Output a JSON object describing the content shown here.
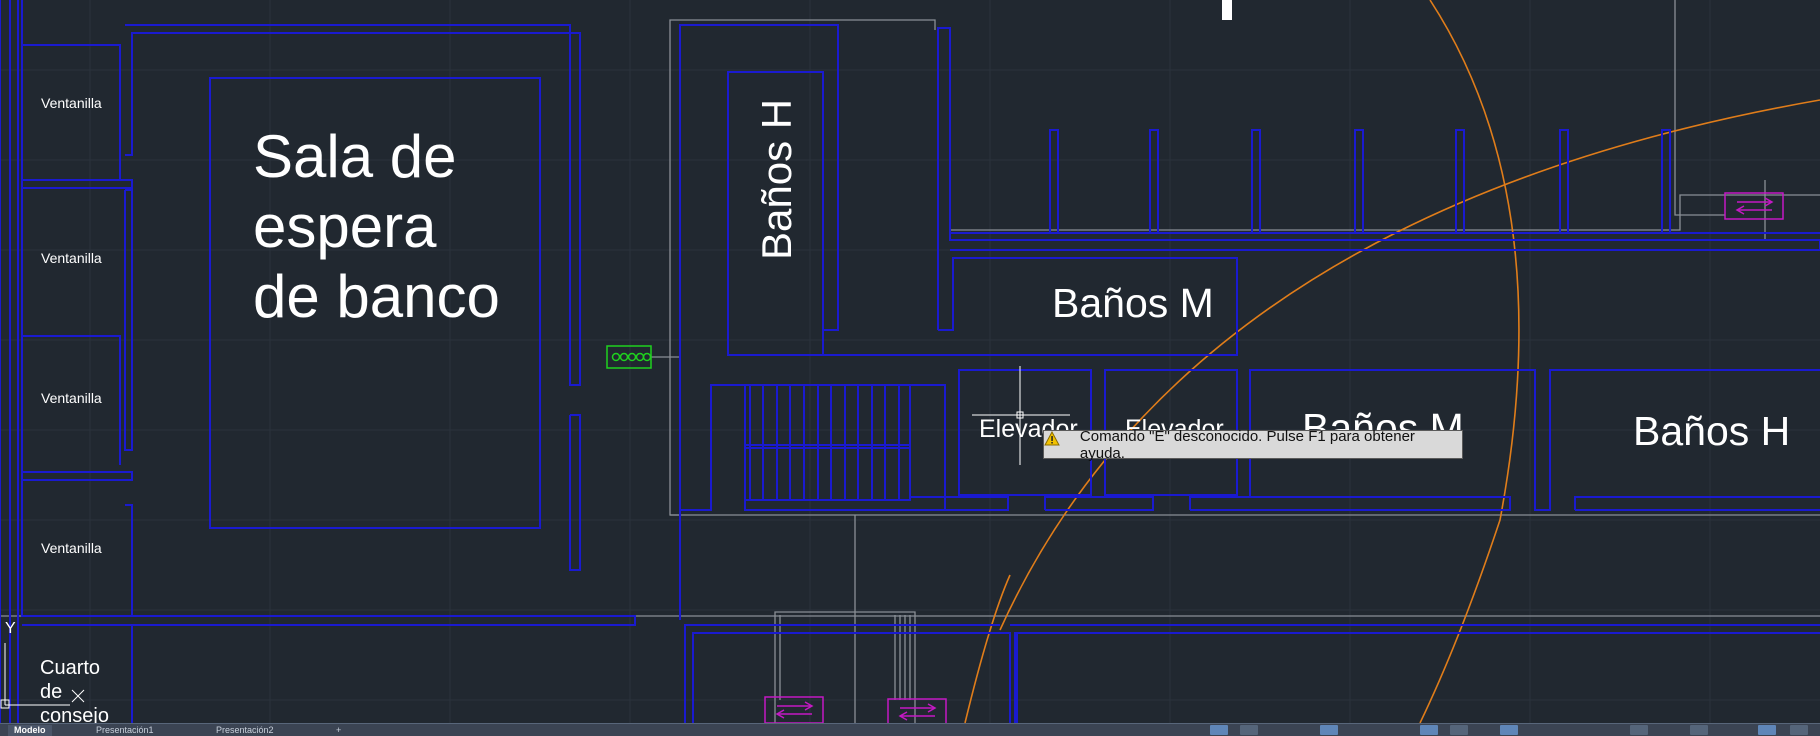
{
  "drawing": {
    "ventanillas": [
      "Ventanilla",
      "Ventanilla",
      "Ventanilla",
      "Ventanilla"
    ],
    "sala": "Sala de espera de banco",
    "banos_h_vertical": "Baños H",
    "banos_m_upper": "Baños M",
    "elevador_1": "Elevador",
    "elevador_2": "Elevador",
    "banos_m_lower": "Baños M",
    "banos_h_right": "Baños H",
    "cuarto": "Cuarto de consejo"
  },
  "tooltip": {
    "icon": "warning-icon",
    "message": "Comando \"E\" desconocido. Pulse F1 para obtener ayuda."
  },
  "ucs": {
    "y_label": "Y"
  },
  "status_bar": {
    "tabs": [
      "Modelo",
      "Presentación1",
      "Presentación2"
    ],
    "add_tab": "+"
  },
  "colors": {
    "background": "#212830",
    "walls": "#1a1ad0",
    "grey_lines": "#8a8f96",
    "arc": "#e07d1a",
    "green_block": "#1fd11f",
    "magenta_block": "#c419c4"
  }
}
